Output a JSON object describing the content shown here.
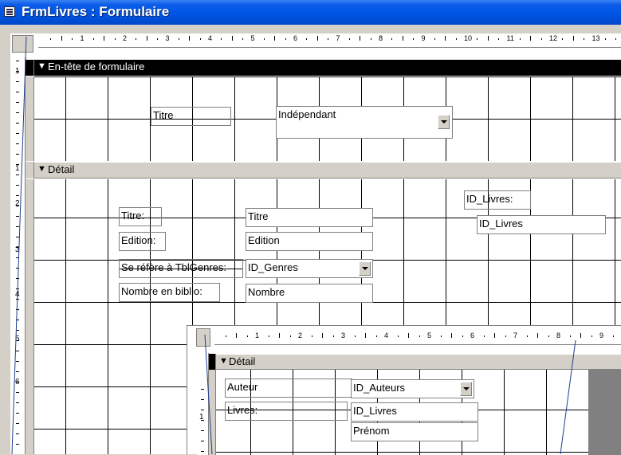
{
  "title_bar": {
    "title": "FrmLivres : Formulaire",
    "icon": "form-window-icon"
  },
  "main_ruler": {
    "numbers": [
      "1",
      "2",
      "3",
      "4",
      "5",
      "6",
      "7",
      "8",
      "9",
      "10",
      "11",
      "12",
      "13"
    ]
  },
  "vertical_ruler": {
    "numbers": [
      "1",
      "1",
      "2",
      "3",
      "4",
      "5",
      "6"
    ]
  },
  "sections": {
    "header": {
      "label": "En-tête de formulaire",
      "icon": "section-marker-icon"
    },
    "detail": {
      "label": "Détail",
      "icon": "section-marker-icon"
    }
  },
  "header_controls": {
    "titre_label": "Titre",
    "titre_combo": "Indépendant"
  },
  "detail_controls": {
    "titre_label": "Titre:",
    "titre_field": "Titre",
    "edition_label": "Edition:",
    "edition_field": "Edition",
    "genres_label": "Se réfère à TblGenres:",
    "genres_combo": "ID_Genres",
    "nombre_label": "Nombre en biblio:",
    "nombre_field": "Nombre",
    "id_livres_label": "ID_Livres:",
    "id_livres_field": "ID_Livres"
  },
  "subform": {
    "ruler_numbers": [
      "1",
      "2",
      "3",
      "4",
      "5",
      "6",
      "7",
      "8",
      "9"
    ],
    "vertical_numbers": [
      "1"
    ],
    "detail_label": "Détail",
    "auteur_label": "Auteur",
    "auteur_combo": "ID_Auteurs",
    "livres_label": "Livres:",
    "livres_field": "ID_Livres",
    "prenom_field": "Prénom"
  }
}
